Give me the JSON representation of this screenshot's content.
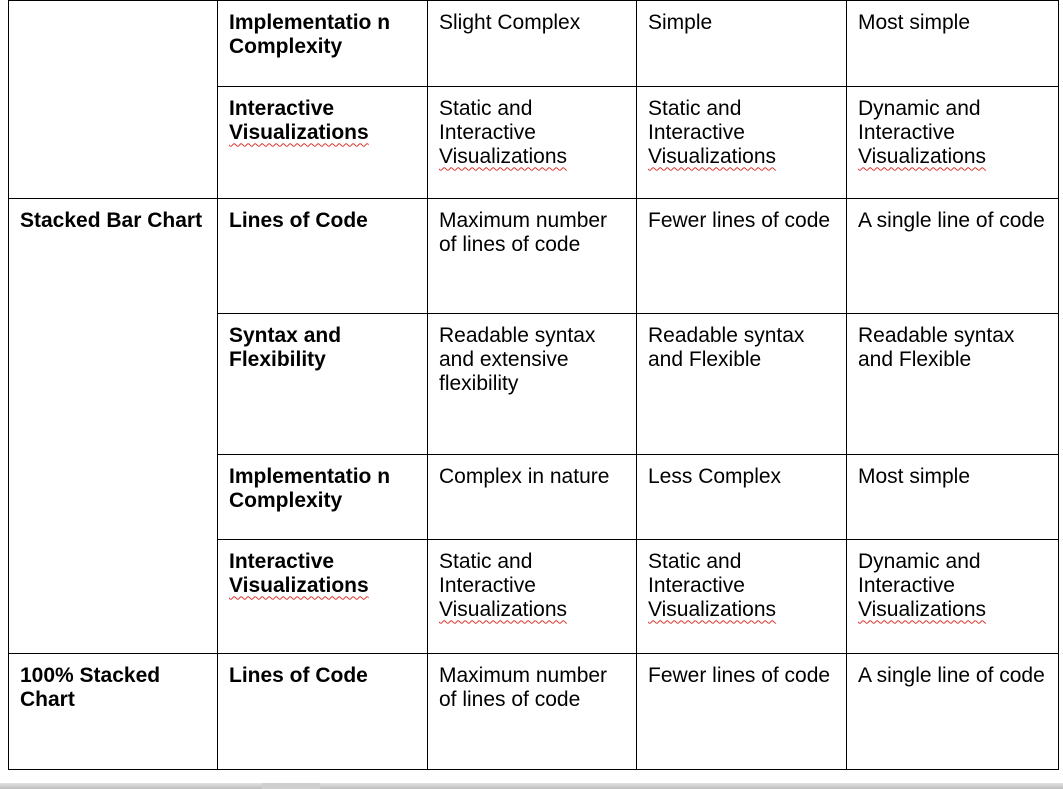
{
  "table": {
    "rows": [
      {
        "group": "",
        "criterion": "Implementatio n Complexity",
        "col1": "Slight Complex",
        "col2": "Simple",
        "col3": "Most simple"
      },
      {
        "group": "",
        "criterion_line1": "Interactive",
        "criterion_line2": "Visualizations",
        "col1_a": "Static and Interactive",
        "col1_b": "Visualizations",
        "col2_a": "Static and Interactive",
        "col2_b": "Visualizations",
        "col3_a": "Dynamic and Interactive",
        "col3_b": "Visualizations"
      },
      {
        "group": "Stacked Bar Chart",
        "criterion": "Lines of Code",
        "col1": "Maximum number of lines of code",
        "col2": "Fewer lines of code",
        "col3": "A single line of code"
      },
      {
        "criterion": "Syntax and Flexibility",
        "col1": "Readable syntax and extensive flexibility",
        "col2": "Readable syntax and Flexible",
        "col3": "Readable syntax  and Flexible"
      },
      {
        "criterion": "Implementatio n Complexity",
        "col1": "Complex in nature",
        "col2": "Less Complex",
        "col3": "Most simple"
      },
      {
        "criterion_line1": "Interactive",
        "criterion_line2": "Visualizations",
        "col1_a": "Static and Interactive",
        "col1_b": "Visualizations",
        "col2_a": "Static and Interactive",
        "col2_b": "Visualizations",
        "col3_a": "Dynamic and Interactive",
        "col3_b": "Visualizations"
      },
      {
        "group": "100% Stacked Chart",
        "criterion": "Lines of Code",
        "col1": "Maximum number of lines of code",
        "col2": "Fewer lines of code",
        "col3": "A single line of code"
      }
    ]
  }
}
